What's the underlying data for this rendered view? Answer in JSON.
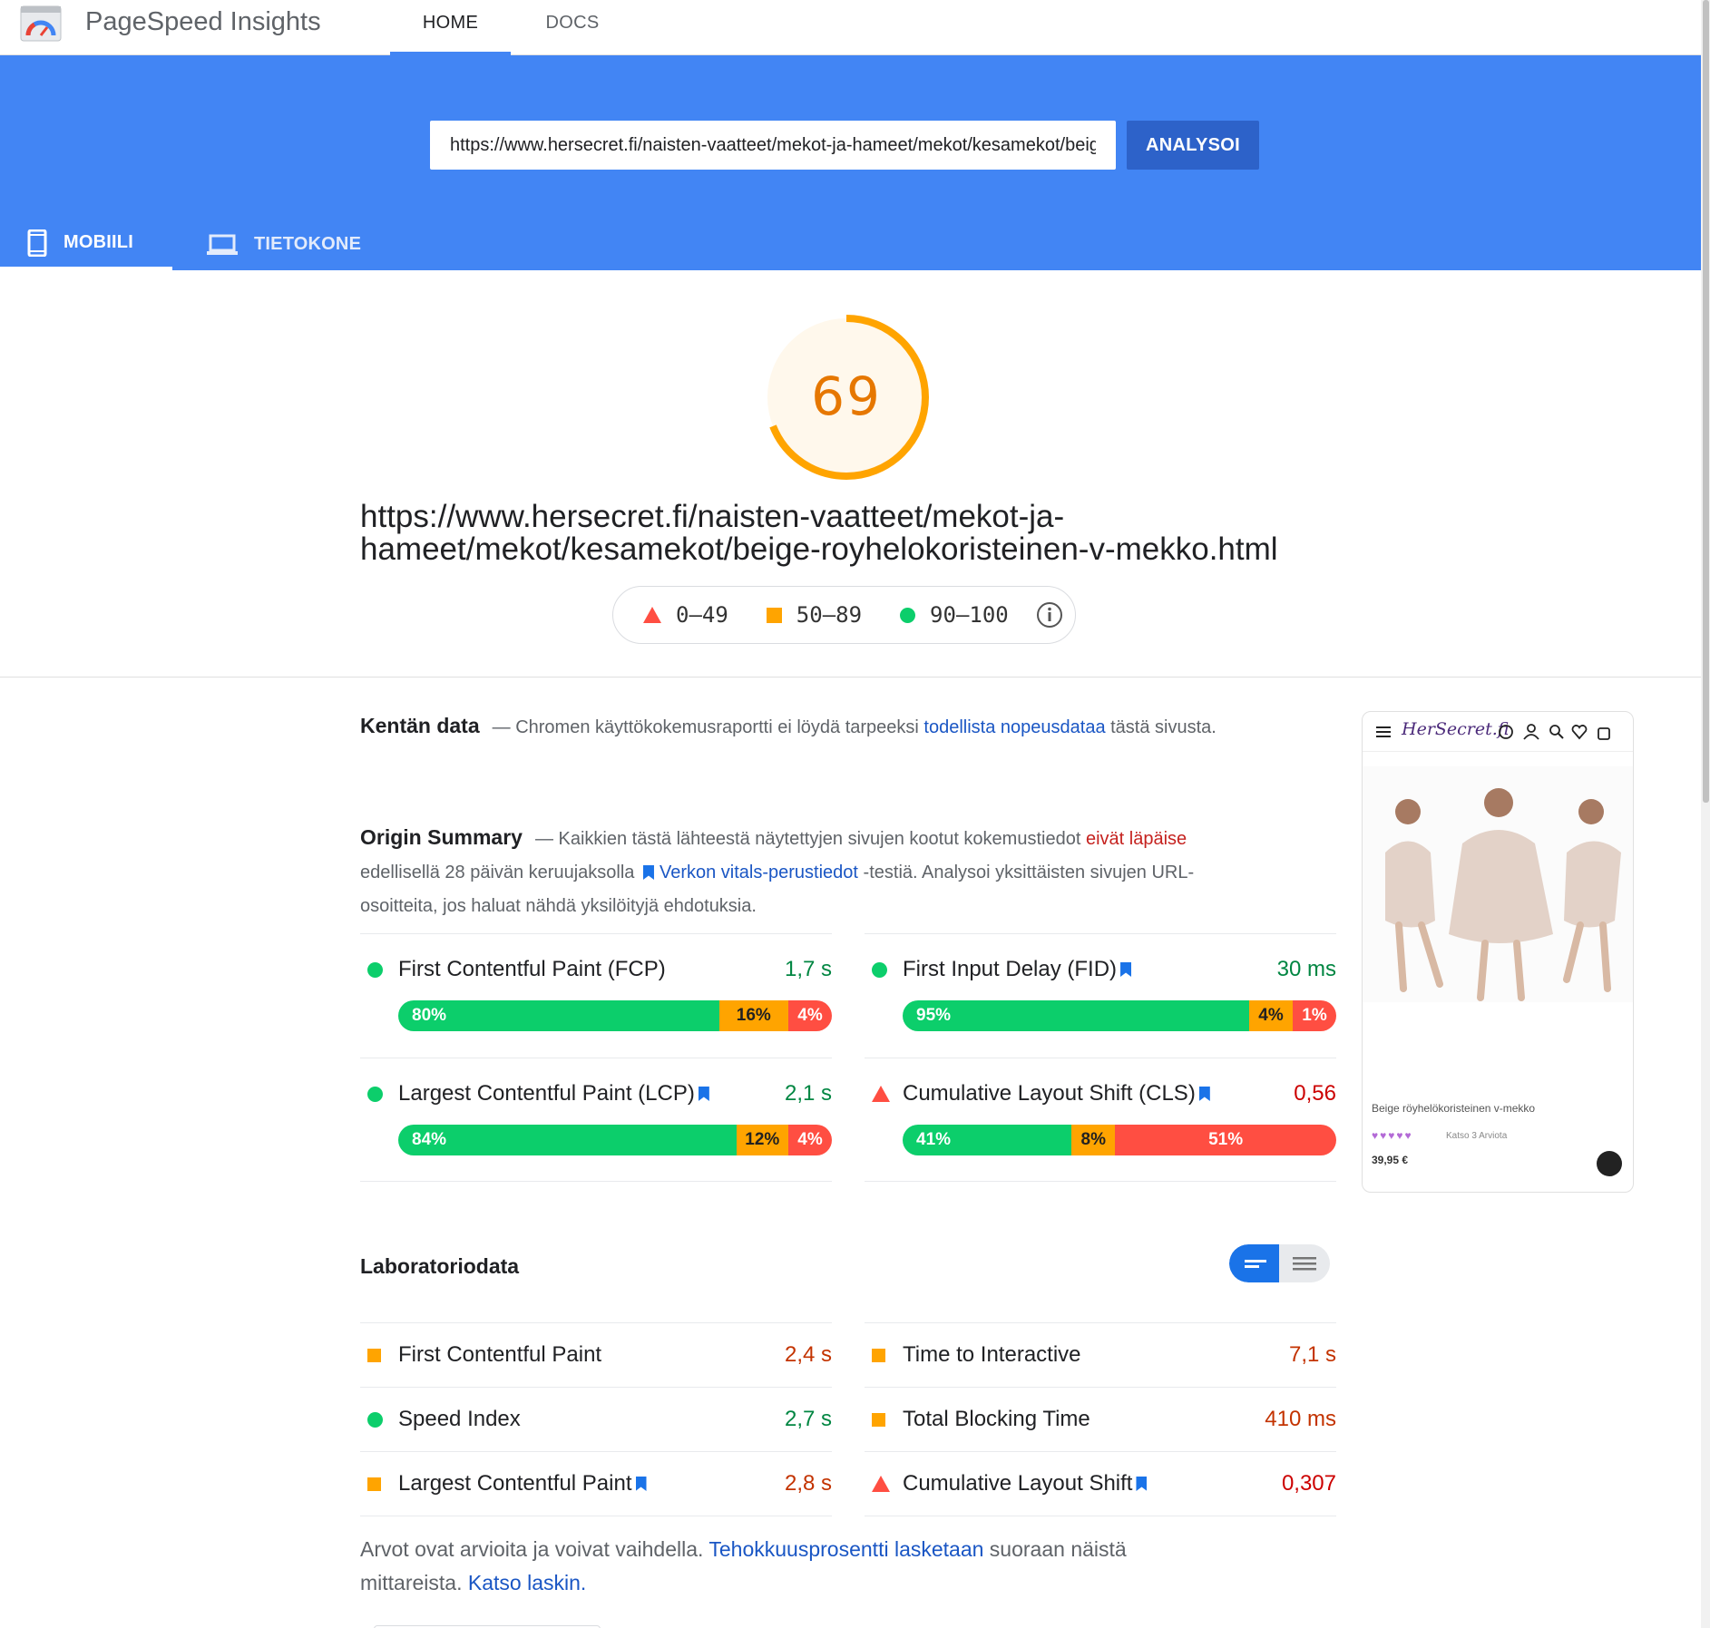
{
  "header": {
    "app_title": "PageSpeed Insights",
    "nav": [
      "HOME",
      "DOCS"
    ],
    "active_nav": "HOME"
  },
  "search": {
    "url_value": "https://www.hersecret.fi/naisten-vaatteet/mekot-ja-hameet/mekot/kesamekot/beige-royhelokoristeinen-v-mekko.html",
    "analyze_label": "ANALYSOI"
  },
  "device_tabs": {
    "mobile": "MOBIILI",
    "desktop": "TIETOKONE",
    "active": "mobile"
  },
  "score": {
    "value": 69,
    "fraction": 0.69,
    "color": "#ffa400",
    "display": "69"
  },
  "report_url": "https://www.hersecret.fi/naisten-vaatteet/mekot-ja-hameet/mekot/kesamekot/beige-royhelokoristeinen-v-mekko.html",
  "legend": {
    "poor": "0–49",
    "average": "50–89",
    "good": "90–100"
  },
  "field_data": {
    "title": "Kentän data",
    "text_before": "— Chromen käyttökokemusraportti ei löydä tarpeeksi ",
    "link": "todellista nopeusdataa",
    "text_after": " tästä sivusta."
  },
  "origin_summary": {
    "title": "Origin Summary",
    "text_1": "— Kaikkien tästä lähteestä näytettyjen sivujen kootut kokemustiedot ",
    "warning": "eivät läpäise",
    "text_2": " edellisellä 28 päivän keruujaksolla ",
    "link": "Verkon vitals-perustiedot",
    "text_3": " -testiä. Analysoi yksittäisten sivujen URL-osoitteita, jos haluat nähdä yksilöityjä ehdotuksia.",
    "metrics": [
      {
        "name": "First Contentful Paint (FCP)",
        "value": "1,7 s",
        "rating": "good",
        "bookmark": false,
        "good_pct": 80,
        "avg_pct": 16,
        "poor_pct": 4,
        "good_label": "80%",
        "avg_label": "16%",
        "poor_label": "4%"
      },
      {
        "name": "First Input Delay (FID)",
        "value": "30 ms",
        "rating": "good",
        "bookmark": true,
        "good_pct": 95,
        "avg_pct": 4,
        "poor_pct": 1,
        "good_label": "95%",
        "avg_label": "4%",
        "poor_label": "1%"
      },
      {
        "name": "Largest Contentful Paint (LCP)",
        "value": "2,1 s",
        "rating": "good",
        "bookmark": true,
        "good_pct": 84,
        "avg_pct": 12,
        "poor_pct": 4,
        "good_label": "84%",
        "avg_label": "12%",
        "poor_label": "4%"
      },
      {
        "name": "Cumulative Layout Shift (CLS)",
        "value": "0,56",
        "rating": "poor",
        "bookmark": true,
        "good_pct": 41,
        "avg_pct": 8,
        "poor_pct": 51,
        "good_label": "41%",
        "avg_label": "8%",
        "poor_label": "51%"
      }
    ]
  },
  "lab_data": {
    "title": "Laboratoriodata",
    "metrics": [
      {
        "name": "First Contentful Paint",
        "value": "2,4 s",
        "rating": "average",
        "bookmark": false
      },
      {
        "name": "Time to Interactive",
        "value": "7,1 s",
        "rating": "average",
        "bookmark": false
      },
      {
        "name": "Speed Index",
        "value": "2,7 s",
        "rating": "good",
        "bookmark": false
      },
      {
        "name": "Total Blocking Time",
        "value": "410 ms",
        "rating": "average",
        "bookmark": false
      },
      {
        "name": "Largest Contentful Paint",
        "value": "2,8 s",
        "rating": "average",
        "bookmark": true
      },
      {
        "name": "Cumulative Layout Shift",
        "value": "0,307",
        "rating": "poor",
        "bookmark": true
      }
    ],
    "note_1": "Arvot ovat arvioita ja voivat vaihdella. ",
    "note_link_1": "Tehokkuusprosentti lasketaan",
    "note_2": " suoraan näistä mittareista. ",
    "note_link_2": "Katso laskin."
  },
  "thumbnail": {
    "brand": "HerSecret.fi",
    "product": "Beige röyhelökoristeinen v-mekko",
    "stars": "♥♥♥♥♥",
    "reviews": "Katso 3 Arviota",
    "price": "39,95 €"
  },
  "colors": {
    "brand_blue": "#4285f4",
    "button_blue": "#2d62c9",
    "good": "#0cce6b",
    "average": "#ffa400",
    "poor": "#ff4e42"
  }
}
